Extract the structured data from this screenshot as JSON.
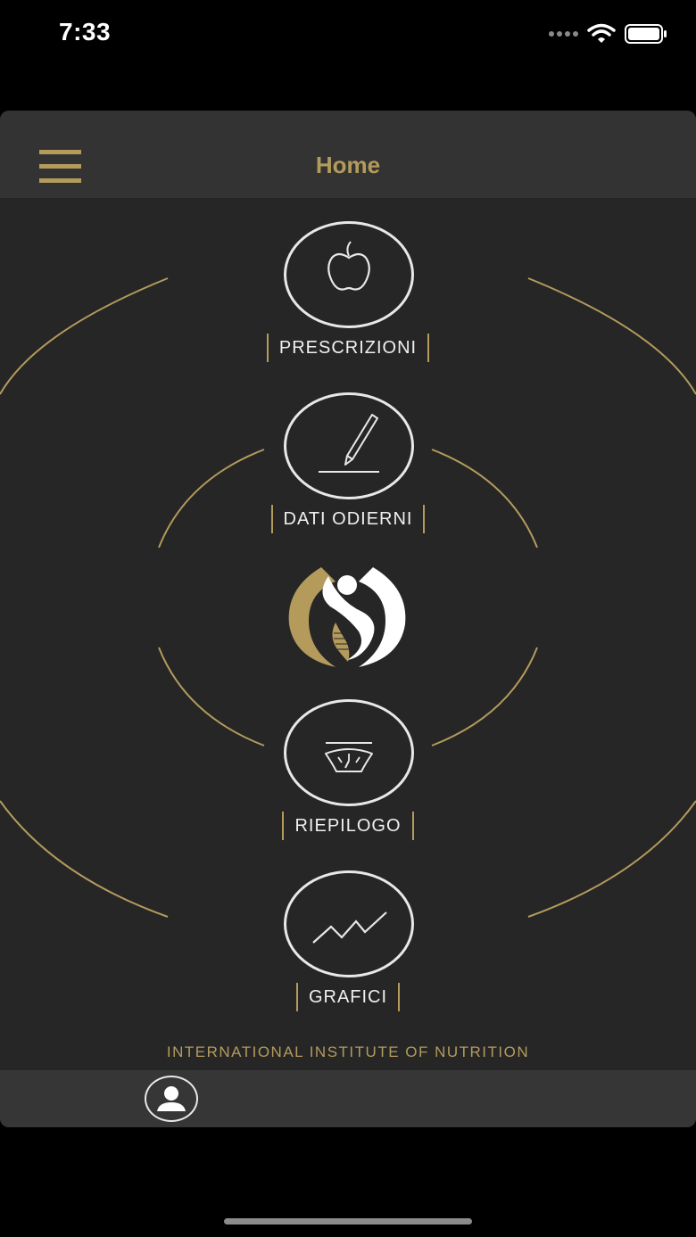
{
  "status_bar": {
    "time": "7:33",
    "icons": [
      "signal-dots-icon",
      "wifi-icon",
      "battery-icon"
    ]
  },
  "navbar": {
    "menu_icon": "hamburger-menu-icon",
    "title": "Home"
  },
  "menu": {
    "items": [
      {
        "label": "PRESCRIZIONI",
        "icon": "apple-icon"
      },
      {
        "label": "DATI ODIERNI",
        "icon": "pencil-icon"
      },
      {
        "label": "RIEPILOGO",
        "icon": "scale-icon"
      },
      {
        "label": "GRAFICI",
        "icon": "chart-line-icon"
      }
    ]
  },
  "logo": {
    "icon": "institute-logo-icon"
  },
  "footer": {
    "text": "INTERNATIONAL INSTITUTE OF NUTRITION"
  },
  "tabbar": {
    "profile_icon": "user-profile-icon"
  },
  "colors": {
    "accent_gold": "#b49b5c",
    "background": "#262626",
    "navbar": "#333333",
    "tabbar": "#363636",
    "icon_white": "#e8e8e8"
  }
}
